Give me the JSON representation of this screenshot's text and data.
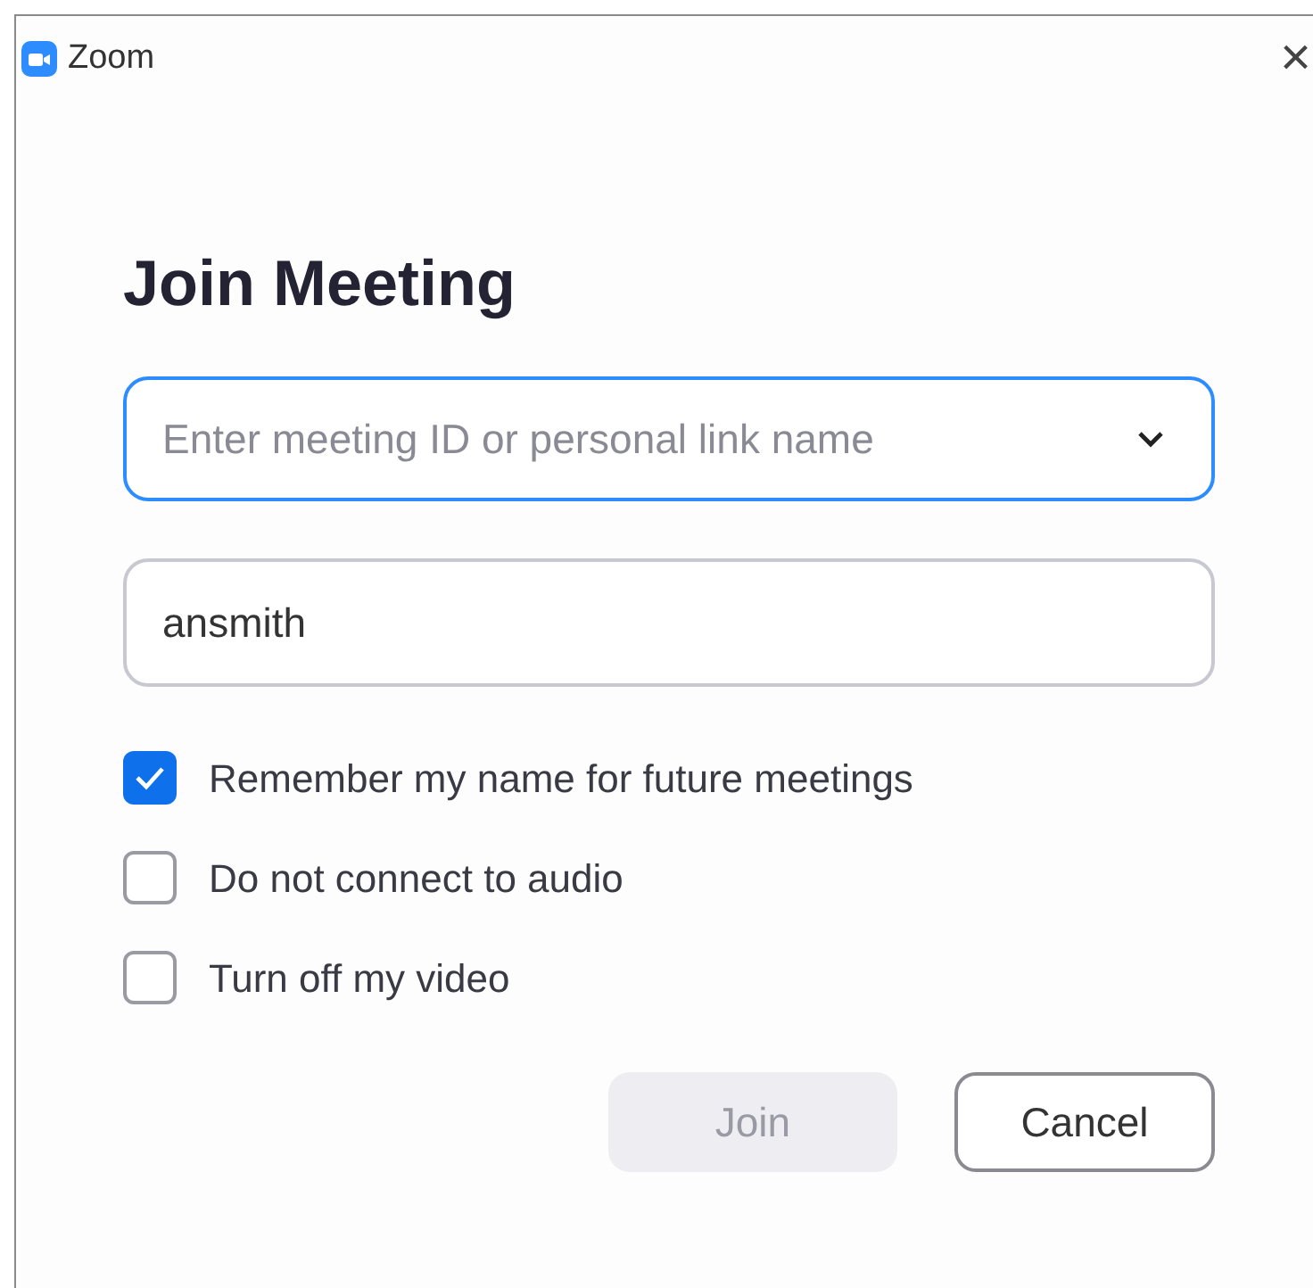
{
  "window": {
    "title": "Zoom",
    "close": "×"
  },
  "heading": "Join Meeting",
  "meeting_field": {
    "placeholder": "Enter meeting ID or personal link name",
    "focused": true
  },
  "name_field": {
    "value": "ansmith"
  },
  "options": [
    {
      "label": "Remember my name for future meetings",
      "checked": true
    },
    {
      "label": "Do not connect to audio",
      "checked": false
    },
    {
      "label": "Turn off my video",
      "checked": false
    }
  ],
  "buttons": [
    {
      "label": "Join",
      "disabled": true
    },
    {
      "label": "Cancel",
      "disabled": false
    }
  ]
}
